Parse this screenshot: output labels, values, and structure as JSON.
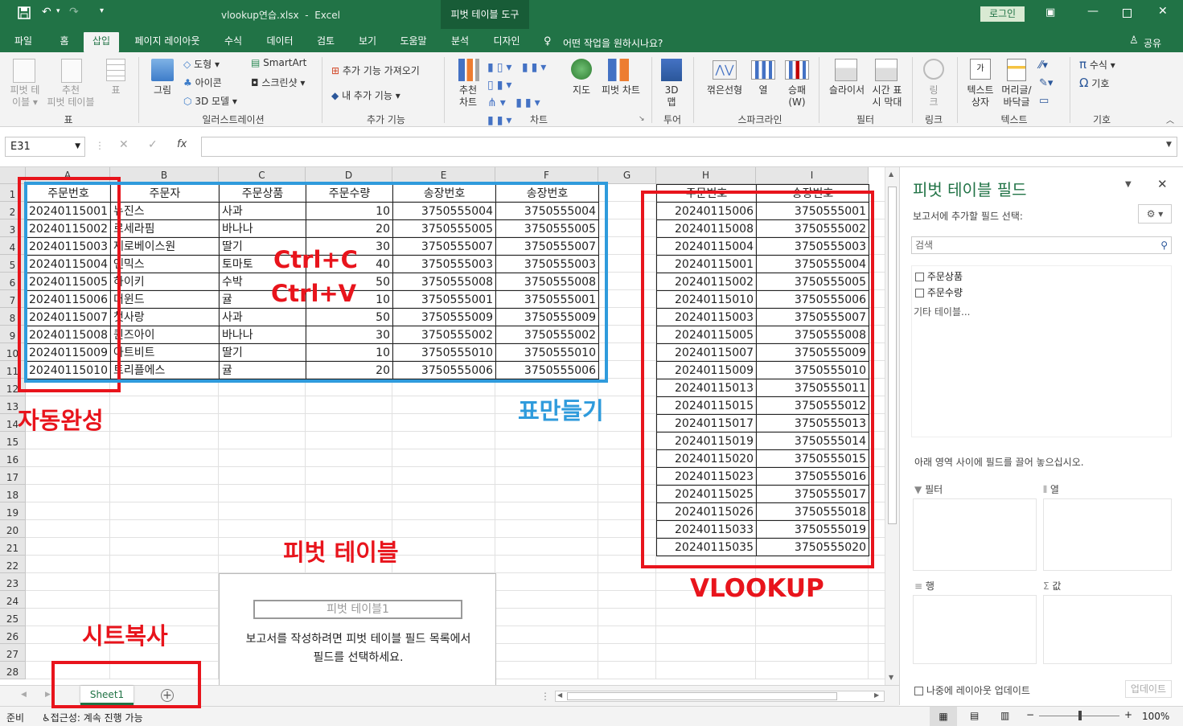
{
  "titlebar": {
    "filename": "vlookup연습.xlsx",
    "app": "Excel",
    "context_tab": "피벗 테이블 도구",
    "login": "로그인"
  },
  "menu": {
    "items": [
      "파일",
      "홈",
      "삽입",
      "페이지 레이아웃",
      "수식",
      "데이터",
      "검토",
      "보기",
      "도움말",
      "분석",
      "디자인"
    ],
    "active": "삽입",
    "tellme": "어떤 작업을 원하시나요?",
    "share": "공유"
  },
  "ribbon": {
    "groups": [
      "표",
      "일러스트레이션",
      "추가 기능",
      "차트",
      "투어",
      "스파크라인",
      "필터",
      "링크",
      "텍스트",
      "기호"
    ],
    "table": {
      "pivot": "피벗 테\n이블 ▾",
      "recommended_pivot": "추천\n피벗 테이블",
      "table": "표"
    },
    "illus": {
      "picture": "그림",
      "shapes": "도형",
      "icons": "아이콘",
      "model3d": "3D 모델",
      "smartart": "SmartArt",
      "screenshot": "스크린샷"
    },
    "addins": {
      "get": "추가 기능 가져오기",
      "my": "내 추가 기능"
    },
    "charts": {
      "recommended": "추천\n차트",
      "maps": "지도",
      "pivotchart": "피벗 차트"
    },
    "tour": {
      "map3d": "3D\n맵"
    },
    "sparklines": {
      "line": "꺾은선형",
      "column": "열",
      "winloss": "승패\n(W)"
    },
    "filters": {
      "slicer": "슬라이서",
      "timeline": "시간 표\n시 막대"
    },
    "links": {
      "link": "링\n크"
    },
    "text": {
      "textbox": "텍스트\n상자",
      "headerfooter": "머리글/\n바닥글"
    },
    "symbols": {
      "equation": "수식",
      "symbol": "기호"
    }
  },
  "formula": {
    "namebox": "E31",
    "fx": "fx",
    "content": ""
  },
  "columns": [
    "A",
    "B",
    "C",
    "D",
    "E",
    "F",
    "G",
    "H",
    "I"
  ],
  "rows": [
    "1",
    "2",
    "3",
    "4",
    "5",
    "6",
    "7",
    "8",
    "9",
    "10",
    "11",
    "12",
    "13",
    "14",
    "15",
    "16",
    "17",
    "18",
    "19",
    "20",
    "21",
    "22",
    "23",
    "24",
    "25",
    "26",
    "27",
    "28"
  ],
  "table1": {
    "headers": [
      "주문번호",
      "주문자",
      "주문상품",
      "주문수량",
      "송장번호",
      "송장번호"
    ],
    "rows": [
      [
        "20240115001",
        "뉴진스",
        "사과",
        "10",
        "3750555004",
        "3750555004"
      ],
      [
        "20240115002",
        "르세라핌",
        "바나나",
        "20",
        "3750555005",
        "3750555005"
      ],
      [
        "20240115003",
        "제로베이스원",
        "딸기",
        "30",
        "3750555007",
        "3750555007"
      ],
      [
        "20240115004",
        "엔믹스",
        "토마토",
        "40",
        "3750555003",
        "3750555003"
      ],
      [
        "20240115005",
        "하이키",
        "수박",
        "50",
        "3750555008",
        "3750555008"
      ],
      [
        "20240115006",
        "더윈드",
        "귤",
        "10",
        "3750555001",
        "3750555001"
      ],
      [
        "20240115007",
        "첫사랑",
        "사과",
        "50",
        "3750555009",
        "3750555009"
      ],
      [
        "20240115008",
        "퀸즈아이",
        "바나나",
        "30",
        "3750555002",
        "3750555002"
      ],
      [
        "20240115009",
        "아트비트",
        "딸기",
        "10",
        "3750555010",
        "3750555010"
      ],
      [
        "20240115010",
        "트리플에스",
        "귤",
        "20",
        "3750555006",
        "3750555006"
      ]
    ]
  },
  "table2": {
    "headers": [
      "주문번호",
      "송장번호"
    ],
    "rows": [
      [
        "20240115006",
        "3750555001"
      ],
      [
        "20240115008",
        "3750555002"
      ],
      [
        "20240115004",
        "3750555003"
      ],
      [
        "20240115001",
        "3750555004"
      ],
      [
        "20240115002",
        "3750555005"
      ],
      [
        "20240115010",
        "3750555006"
      ],
      [
        "20240115003",
        "3750555007"
      ],
      [
        "20240115005",
        "3750555008"
      ],
      [
        "20240115007",
        "3750555009"
      ],
      [
        "20240115009",
        "3750555010"
      ],
      [
        "20240115013",
        "3750555011"
      ],
      [
        "20240115015",
        "3750555012"
      ],
      [
        "20240115017",
        "3750555013"
      ],
      [
        "20240115019",
        "3750555014"
      ],
      [
        "20240115020",
        "3750555015"
      ],
      [
        "20240115023",
        "3750555016"
      ],
      [
        "20240115025",
        "3750555017"
      ],
      [
        "20240115026",
        "3750555018"
      ],
      [
        "20240115033",
        "3750555019"
      ],
      [
        "20240115035",
        "3750555020"
      ]
    ]
  },
  "pivot_placeholder": {
    "name": "피벗 테이블1",
    "msg1": "보고서를 작성하려면 피벗 테이블 필드 목록에서",
    "msg2": "필드를 선택하세요."
  },
  "annotations": {
    "autofill": "자동완성",
    "ctrlc": "Ctrl+C",
    "ctrlv": "Ctrl+V",
    "maketable": "표만들기",
    "pivot": "피벗 테이블",
    "vlookup": "VLOOKUP",
    "sheetcopy": "시트복사"
  },
  "pane": {
    "title": "피벗 테이블 필드",
    "subtitle": "보고서에 추가할 필드 선택:",
    "search_placeholder": "검색",
    "fields": [
      "주문상품",
      "주문수량"
    ],
    "other": "기타 테이블...",
    "drag_msg": "아래 영역 사이에 필드를 끌어 놓으십시오.",
    "areas": [
      "필터",
      "열",
      "행",
      "값"
    ],
    "defer": "나중에 레이아웃 업데이트",
    "update": "업데이트"
  },
  "sheets": {
    "tabs": [
      "Sheet1"
    ]
  },
  "status": {
    "ready": "준비",
    "accessibility": "접근성: 계속 진행 가능",
    "zoom": "100%"
  },
  "colors": {
    "excel_green": "#217346",
    "annot_red": "#e8141c",
    "annot_blue": "#2f9bdc"
  }
}
